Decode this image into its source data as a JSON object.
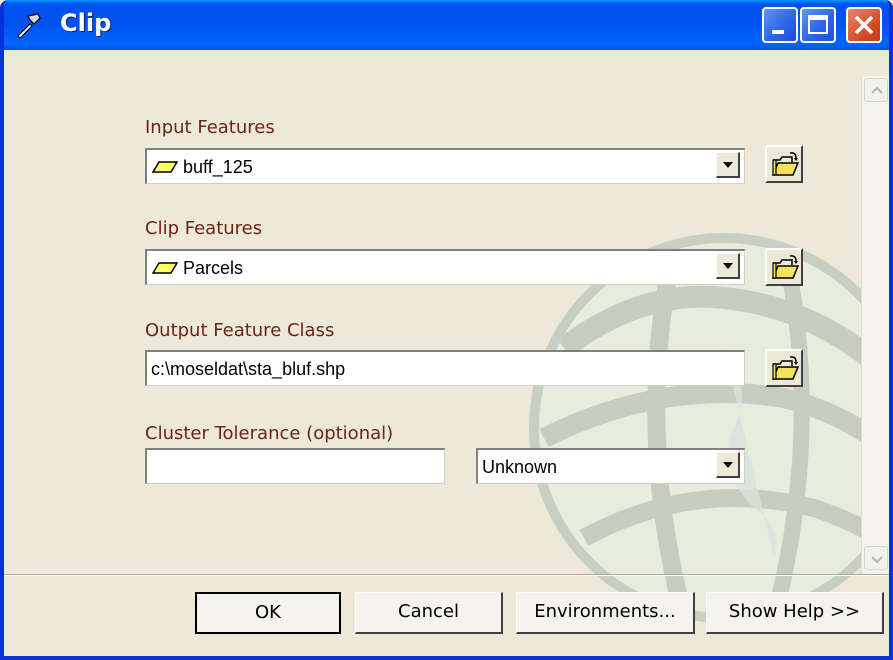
{
  "window": {
    "title": "Clip",
    "icon": "hammer-icon"
  },
  "form": {
    "input_features": {
      "label": "Input Features",
      "value": "buff_125",
      "icon": "polygon-layer-icon"
    },
    "clip_features": {
      "label": "Clip Features",
      "value": "Parcels",
      "icon": "polygon-layer-icon"
    },
    "output_feature_class": {
      "label": "Output Feature Class",
      "value": "c:\\moseldat\\sta_bluf.shp"
    },
    "cluster_tolerance": {
      "label": "Cluster Tolerance (optional)",
      "value": "",
      "units": "Unknown"
    }
  },
  "buttons": {
    "ok": "OK",
    "cancel": "Cancel",
    "environments": "Environments...",
    "show_help": "Show Help >>"
  },
  "colors": {
    "label_text": "#6b2418",
    "titlebar": "#0054e3",
    "dialog_bg": "#ece9d8"
  }
}
